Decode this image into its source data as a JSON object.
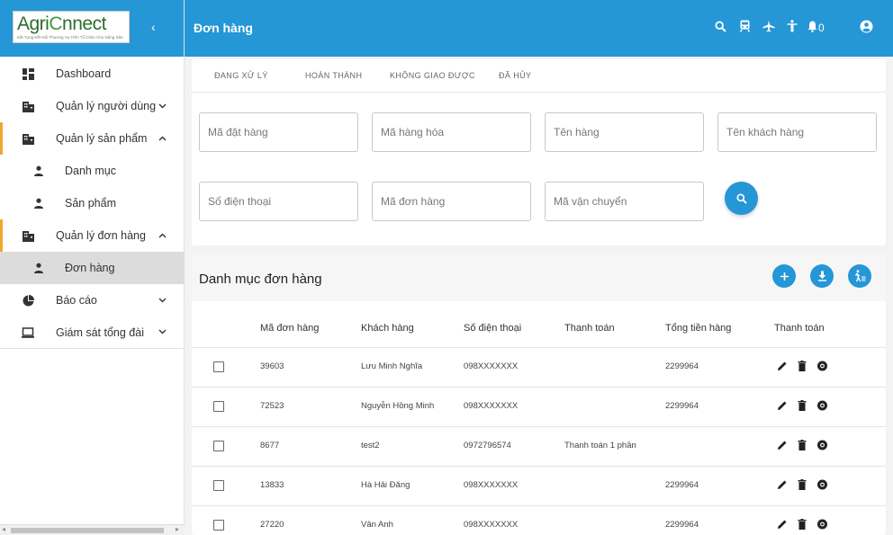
{
  "logo": {
    "brand_part1": "Agri",
    "brand_part2": "C",
    "brand_part3": "nnect",
    "tagline": "Kết Tụng Kết Nổi Thương Vụ Trên Tổ Chim Cho Nông Sản"
  },
  "sidebar": {
    "items": [
      {
        "label": "Dashboard",
        "icon": "dashboard-icon"
      },
      {
        "label": "Quản lý người dùng",
        "icon": "building-icon",
        "chevron": "down"
      },
      {
        "label": "Quản lý sản phẩm",
        "icon": "building-icon",
        "chevron": "up"
      },
      {
        "label": "Danh mục",
        "icon": "person-icon"
      },
      {
        "label": "Sản phẩm",
        "icon": "person-icon"
      },
      {
        "label": "Quản lý đơn hàng",
        "icon": "building-icon",
        "chevron": "up"
      },
      {
        "label": "Đơn hàng",
        "icon": "person-icon"
      },
      {
        "label": "Báo cáo",
        "icon": "pie-chart-icon",
        "chevron": "down"
      },
      {
        "label": "Giám sát tổng đài",
        "icon": "laptop-icon",
        "chevron": "down"
      }
    ]
  },
  "topbar": {
    "title": "Đơn hàng",
    "notification_count": "0"
  },
  "tabs": [
    "ĐANG XỬ LÝ",
    "HOÀN THÀNH",
    "KHÔNG GIAO ĐƯỢC",
    "ĐÃ HỦY"
  ],
  "filters": {
    "order_code": "Mã đặt hàng",
    "product_code": "Mã hàng hóa",
    "product_name": "Tên hàng",
    "customer_name": "Tên khách hàng",
    "phone": "Số điện thoại",
    "order_number": "Mã đơn hàng",
    "shipping_code": "Mã vận chuyển"
  },
  "table": {
    "title": "Danh mục đơn hàng",
    "columns": [
      "Mã đơn hàng",
      "Khách hàng",
      "Số điện thoại",
      "Thanh toán",
      "Tổng tiền hàng",
      "Thanh toán"
    ],
    "rows": [
      {
        "code": "39603",
        "customer": "Lưu Minh Nghĩa",
        "phone": "098XXXXXXX",
        "payment": "",
        "total": "2299964"
      },
      {
        "code": "72523",
        "customer": "Nguyễn Hồng Minh",
        "phone": "098XXXXXXX",
        "payment": "",
        "total": "2299964"
      },
      {
        "code": "8677",
        "customer": "test2",
        "phone": "0972796574",
        "payment": "Thanh toán 1 phần",
        "total": ""
      },
      {
        "code": "13833",
        "customer": "Hà Hải Đăng",
        "phone": "098XXXXXXX",
        "payment": "",
        "total": "2299964"
      },
      {
        "code": "27220",
        "customer": "Vân Anh",
        "phone": "098XXXXXXX",
        "payment": "",
        "total": "2299964"
      }
    ]
  },
  "colors": {
    "primary": "#2596d6",
    "accent": "#f0a830",
    "active_bg": "#dcdcdc"
  }
}
